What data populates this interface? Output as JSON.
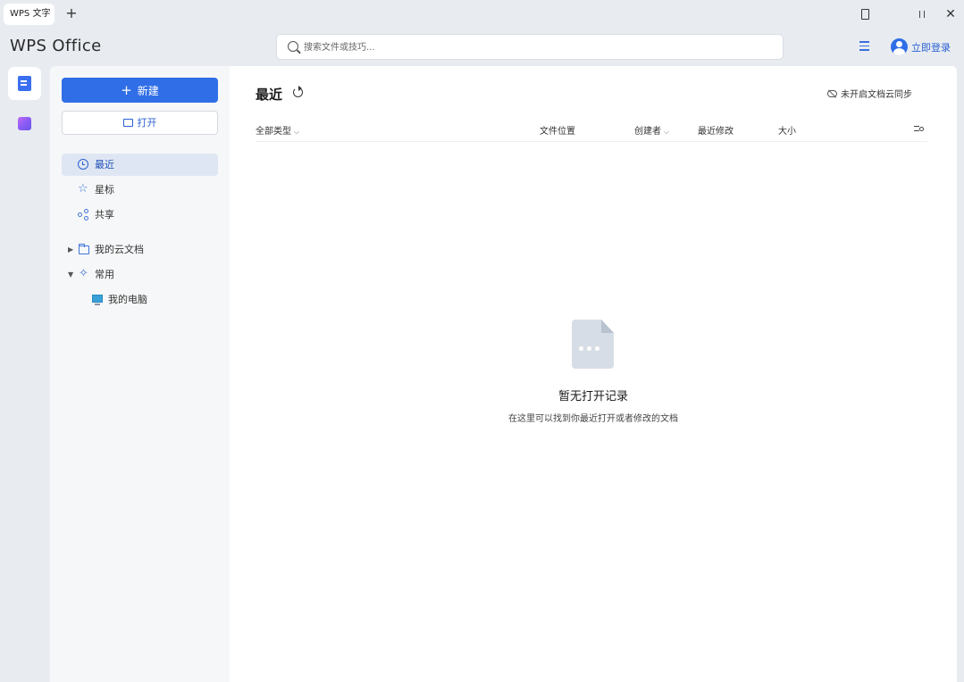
{
  "titlebar": {
    "tab_label": "WPS 文字",
    "new_tab_symbol": "+",
    "close_symbol": "✕"
  },
  "header": {
    "logo": "WPS Office",
    "search_placeholder": "搜索文件或技巧...",
    "login_label": "立即登录"
  },
  "sidebar": {
    "new_label": "新建",
    "open_label": "打开",
    "nav": [
      {
        "label": "最近",
        "icon": "clock-icon",
        "active": true
      },
      {
        "label": "星标",
        "icon": "star-icon",
        "active": false
      },
      {
        "label": "共享",
        "icon": "share-icon",
        "active": false
      }
    ],
    "tree": [
      {
        "label": "我的云文档",
        "icon": "folder-icon",
        "arrow": "▶"
      },
      {
        "label": "常用",
        "icon": "pin-icon",
        "arrow": "▼"
      },
      {
        "label": "我的电脑",
        "icon": "computer-icon"
      }
    ]
  },
  "main": {
    "title": "最近",
    "sync_label": "未开启文档云同步",
    "columns": {
      "type_filter": "全部类型",
      "location": "文件位置",
      "creator": "创建者",
      "modified": "最近修改",
      "size": "大小"
    },
    "empty": {
      "title": "暂无打开记录",
      "subtitle": "在这里可以找到你最近打开或者修改的文档"
    }
  },
  "colors": {
    "accent": "#2f6ee6",
    "sidebar_bg": "#f6f7f8",
    "app_bg": "#e8ecf1",
    "active_nav_bg": "#dfe6f3"
  }
}
